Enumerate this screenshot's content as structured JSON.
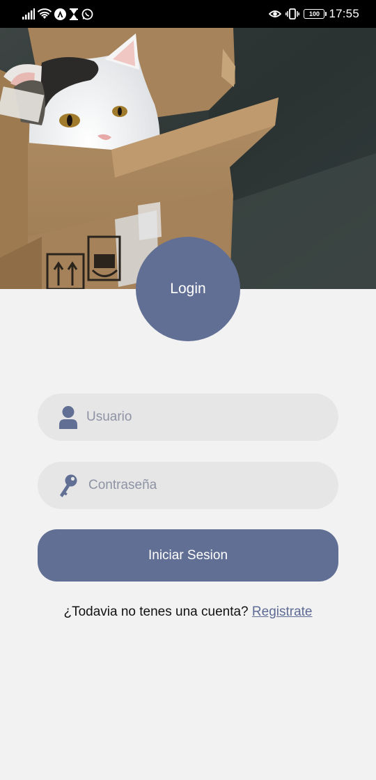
{
  "status_bar": {
    "time": "17:55",
    "battery": "100",
    "left_icons": [
      "signal-icon",
      "wifi-icon",
      "vpn-icon",
      "hourglass-icon",
      "whatsapp-icon"
    ],
    "right_icons": [
      "eye-icon",
      "vibrate-icon",
      "battery-icon"
    ]
  },
  "hero": {
    "image": "cat-in-cardboard-box"
  },
  "header": {
    "title": "Login"
  },
  "form": {
    "username": {
      "placeholder": "Usuario",
      "value": "",
      "icon": "user-icon"
    },
    "password": {
      "placeholder": "Contraseña",
      "value": "",
      "icon": "key-icon"
    },
    "submit_label": "Iniciar Sesion"
  },
  "footer": {
    "prompt": "¿Todavia no tenes una cuenta?",
    "link_label": "Registrate"
  },
  "colors": {
    "accent": "#626f95",
    "background": "#f2f2f3",
    "field_bg": "#e6e6e7",
    "link": "#5d6a93"
  }
}
